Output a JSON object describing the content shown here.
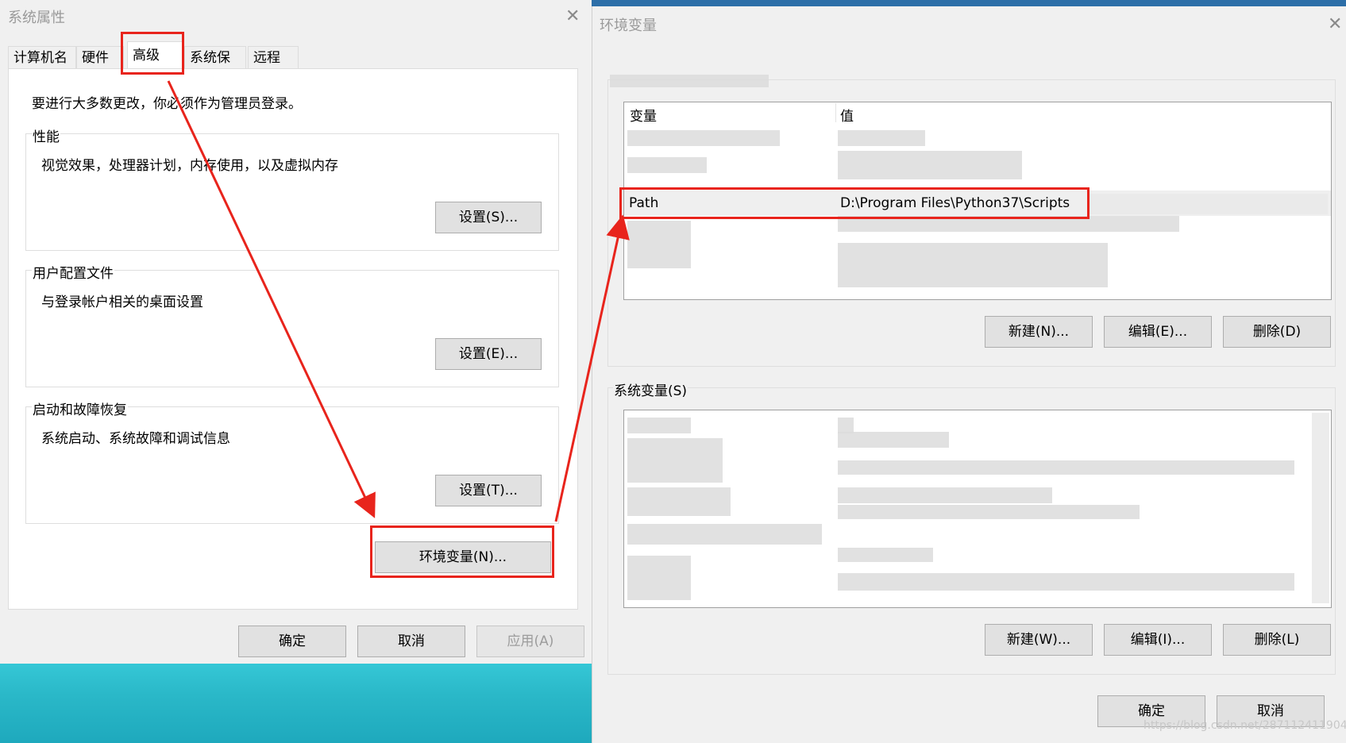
{
  "system_properties": {
    "title": "系统属性",
    "tabs": [
      {
        "label": "计算机名"
      },
      {
        "label": "硬件"
      },
      {
        "label": "高级"
      },
      {
        "label": "系统保护"
      },
      {
        "label": "远程"
      }
    ],
    "admin_note": "要进行大多数更改，你必须作为管理员登录。",
    "groups": {
      "performance": {
        "label": "性能",
        "description": "视觉效果，处理器计划，内存使用，以及虚拟内存",
        "button": "设置(S)..."
      },
      "user_profiles": {
        "label": "用户配置文件",
        "description": "与登录帐户相关的桌面设置",
        "button": "设置(E)..."
      },
      "startup_recovery": {
        "label": "启动和故障恢复",
        "description": "系统启动、系统故障和调试信息",
        "button": "设置(T)..."
      }
    },
    "env_button": "环境变量(N)...",
    "footer": {
      "ok": "确定",
      "cancel": "取消",
      "apply": "应用(A)"
    }
  },
  "environment_variables": {
    "title": "环境变量",
    "user_vars": {
      "columns": {
        "name": "变量",
        "value": "值"
      },
      "selected_row": {
        "name": "Path",
        "value": "D:\\Program Files\\Python37\\Scripts"
      },
      "buttons": {
        "new": "新建(N)...",
        "edit": "编辑(E)...",
        "delete": "删除(D)"
      }
    },
    "system_vars": {
      "label": "系统变量(S)",
      "buttons": {
        "new": "新建(W)...",
        "edit": "编辑(I)...",
        "delete": "删除(L)"
      }
    },
    "footer": {
      "ok": "确定",
      "cancel": "取消"
    }
  },
  "annotations": {
    "color": "#e8241c"
  },
  "watermark": "https://blog.csdn.net/287112411904"
}
